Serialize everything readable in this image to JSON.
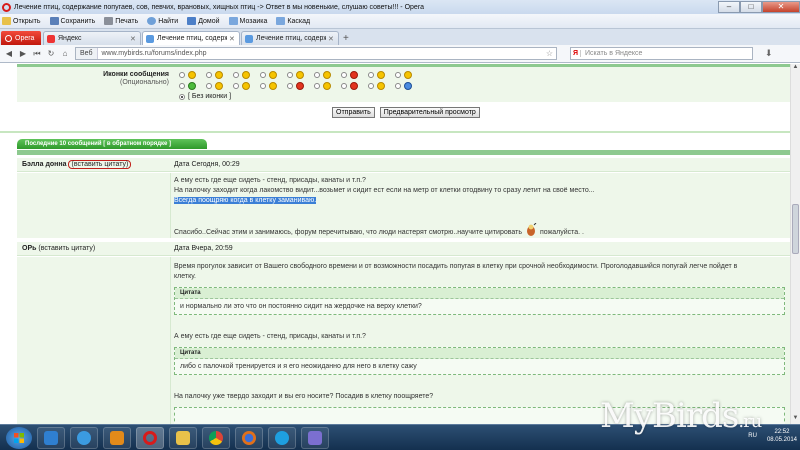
{
  "window": {
    "title": "Лечение птиц, содержание попугаев, сов, певчих, врановых, хищных птиц -> Ответ в мы новенькие, слушаю советы!!! - Opera",
    "controls": [
      "–",
      "□",
      "✕"
    ]
  },
  "menubar": {
    "items": [
      {
        "label": "Открыть",
        "icon": "folder-icon"
      },
      {
        "label": "Сохранить",
        "icon": "save-icon"
      },
      {
        "label": "Печать",
        "icon": "print-icon"
      },
      {
        "label": "Найти",
        "icon": "find-icon"
      },
      {
        "label": "Домой",
        "icon": "home-icon"
      },
      {
        "label": "Мозаика",
        "icon": "tile-icon"
      },
      {
        "label": "Каскад",
        "icon": "cascade-icon"
      }
    ]
  },
  "tabs": {
    "opera_label": "Opera",
    "items": [
      {
        "label": "Яндекс",
        "active": false
      },
      {
        "label": "Лечение птиц, содерж...",
        "active": true
      },
      {
        "label": "Лечение птиц, содерж...",
        "active": false
      }
    ],
    "new_tab": "+"
  },
  "address": {
    "site_label": "Веб",
    "url": "www.mybirds.ru/forums/index.php",
    "search_placeholder": "Искать в Яндексе"
  },
  "form": {
    "icons_label": "Иконки сообщения",
    "icons_optional": "(Опционально)",
    "no_icons": "[ Без иконки ]",
    "submit": "Отправить",
    "preview": "Предварительный просмотр"
  },
  "section": {
    "last_messages": "Последние 10 сообщений [ в обратном порядке ]"
  },
  "posts": [
    {
      "author": "Бэлла донна",
      "quote_link": "(вставить цитату)",
      "date": "Дата Сегодня, 00:29",
      "lines": [
        "А ему есть где еще сидеть - стенд, присады, канаты и т.п.?",
        "На палочку заходит когда лакомство видит...возьмет и сидит ест если на метр от клетки отодвину то сразу летит на своё место...",
        "Всегда поощряю когда в клетку заманиваю.",
        "Спасибо..Сейчас этим и занимаюсь, форум перечитываю, что люди настерят смотрю..научите цитировать",
        "пожалуйста. ."
      ]
    },
    {
      "author": "ОРь",
      "quote_link": "(вставить цитату)",
      "date": "Дата Вчера, 20:59",
      "intro": [
        "Время прогулок зависит от Вашего свободного времени и от возможности посадить попугая в клетку при срочной необходимости. Проголодавшийся попугай легче пойдет в",
        "клетку."
      ],
      "quotes": [
        {
          "title": "Цитата",
          "text": "и нормально ли это что он постоянно сидит на жердочке на верху клетки?"
        },
        {
          "title": "Цитата",
          "text": "либо с палочкой тренируется и я его неожиданно для него в клетку сажу"
        }
      ],
      "mid": "А ему есть где еще сидеть - стенд, присады, канаты и т.п.?",
      "tail": "На палочку уже твердо заходит и вы его носите? Посадив в клетку поощряете?"
    }
  ],
  "taskbar": {
    "apps": [
      {
        "name": "explorer-app",
        "color": "#2f7fd0"
      },
      {
        "name": "ie-app",
        "color": "#3b9be0"
      },
      {
        "name": "media-app",
        "color": "#e28a1a"
      },
      {
        "name": "opera-app",
        "color": "#d81b1b"
      },
      {
        "name": "folder-app",
        "color": "#e8c14a"
      },
      {
        "name": "chrome-app",
        "color": "#4caf50"
      },
      {
        "name": "firefox-app",
        "color": "#e0701a"
      },
      {
        "name": "skype-app",
        "color": "#1e9fe0"
      },
      {
        "name": "paint-app",
        "color": "#7b6fd0"
      }
    ],
    "lang": "RU",
    "time": "22:52",
    "date": "08.05.2014"
  },
  "watermark": {
    "text": "MyBirds",
    "suffix": ".ru"
  },
  "colors": {
    "panel_green": "#eef7ea",
    "bar_green": "#8dc98f",
    "button_green": "#2f9a2b",
    "highlight": "#3b7fd6",
    "circle_red": "#c0201a"
  }
}
